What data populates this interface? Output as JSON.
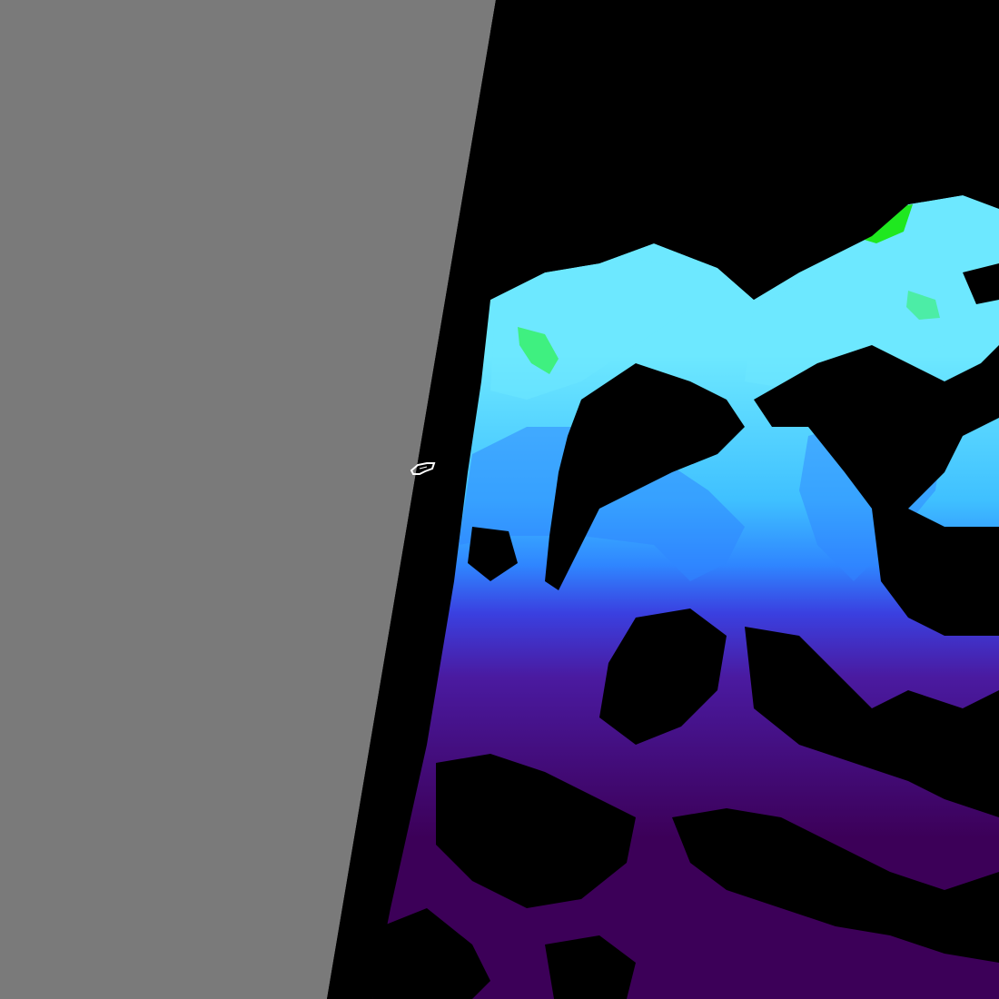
{
  "scene": {
    "kind": "satellite ocean-color swath (false-color)",
    "colors": {
      "no_coverage": "#7a7a7a",
      "masked": "#000000",
      "land_outline": "#ffffff",
      "very_low": "#3c0058",
      "low": "#4a1aa0",
      "moderate_low": "#3a40e0",
      "moderate": "#2f86ff",
      "moderate_high": "#3fc0ff",
      "high": "#6de8ff",
      "very_high": "#3ff080",
      "peak": "#1fe81f"
    }
  }
}
